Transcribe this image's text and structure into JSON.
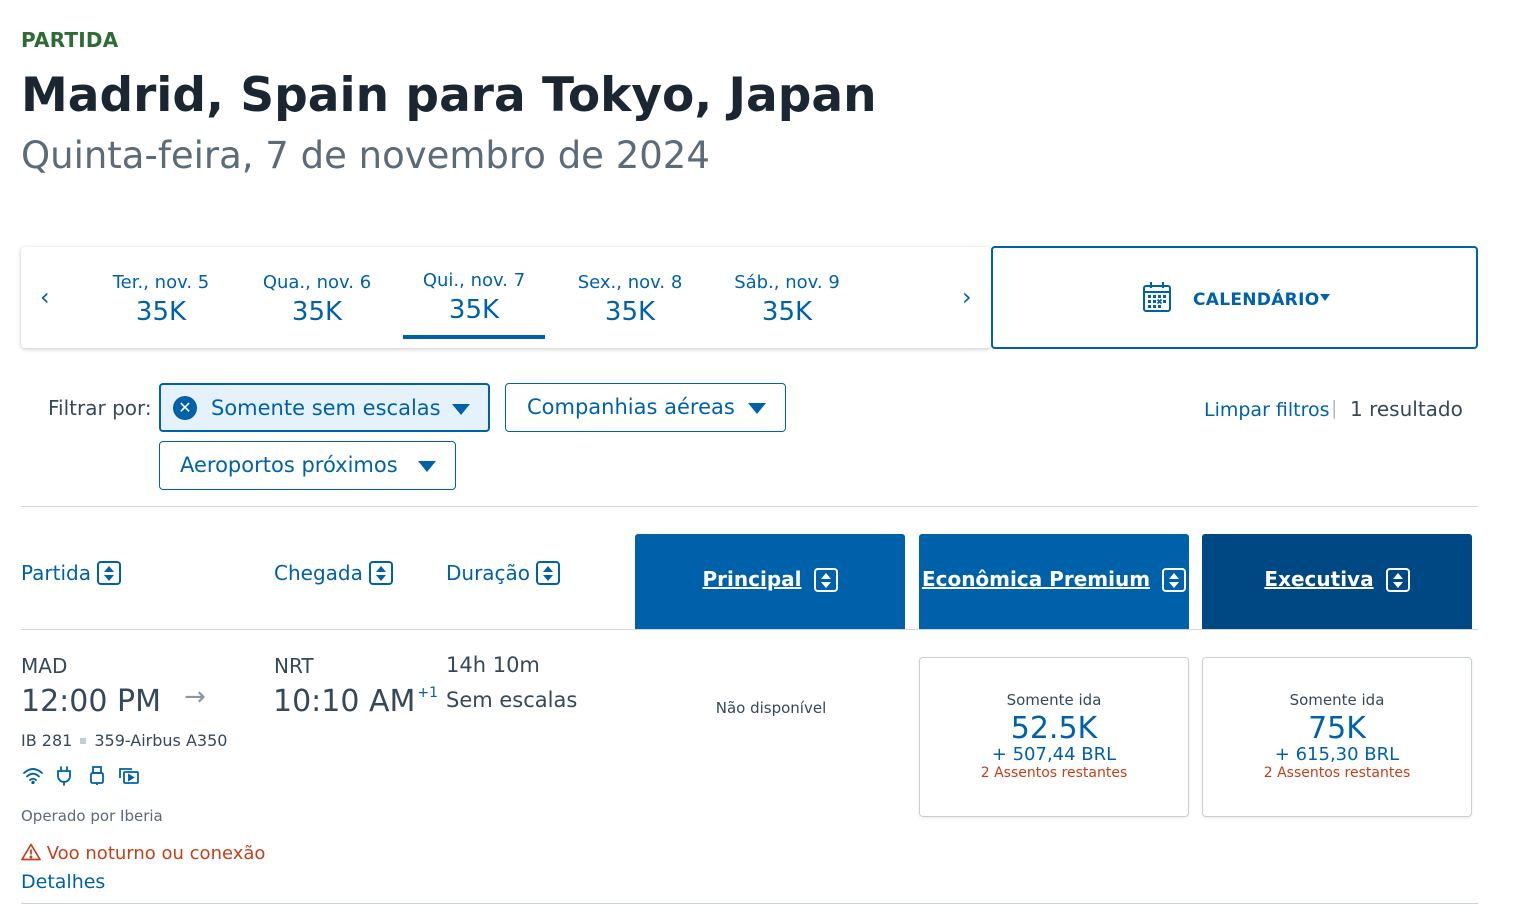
{
  "header": {
    "eyebrow": "PARTIDA",
    "route": "Madrid, Spain para Tokyo, Japan",
    "date": "Quinta-feira, 7 de novembro de 2024"
  },
  "date_strip": {
    "prev": "‹",
    "next": "›",
    "days": [
      {
        "label": "Ter., nov. 5",
        "price": "35K"
      },
      {
        "label": "Qua., nov. 6",
        "price": "35K"
      },
      {
        "label": "Qui., nov. 7",
        "price": "35K",
        "selected": true
      },
      {
        "label": "Sex., nov. 8",
        "price": "35K"
      },
      {
        "label": "Sáb., nov. 9",
        "price": "35K"
      }
    ],
    "calendar_label": "CALENDÁRIO"
  },
  "filters": {
    "label": "Filtrar por:",
    "chips": [
      {
        "label": "Somente sem escalas",
        "selected": true
      },
      {
        "label": "Companhias aéreas"
      },
      {
        "label": "Aeroportos próximos"
      }
    ],
    "clear": "Limpar filtros",
    "separator": "|",
    "results": "1 resultado"
  },
  "columns": {
    "departure": "Partida",
    "arrival": "Chegada",
    "duration": "Duração",
    "cabins": [
      "Principal",
      "Econômica Premium",
      "Executiva"
    ]
  },
  "flight": {
    "origin": "MAD",
    "depart_time": "12:00 PM",
    "destination": "NRT",
    "arrive_time": "10:10 AM",
    "day_offset": "+1",
    "duration": "14h 10m",
    "stops": "Sem escalas",
    "flight_number": "IB 281",
    "aircraft": "359-Airbus A350",
    "amenities": [
      "wifi-icon",
      "power-outlet-icon",
      "usb-icon",
      "entertainment-icon"
    ],
    "operated_by": "Operado por Iberia",
    "warning": "Voo noturno ou conexão",
    "details": "Detalhes",
    "fares": {
      "principal": "Não disponível",
      "premium": {
        "type": "Somente ida",
        "price": "52.5K",
        "cash": "+ 507,44 BRL",
        "seats": "2 Assentos restantes"
      },
      "executiva": {
        "type": "Somente ida",
        "price": "75K",
        "cash": "+ 615,30 BRL",
        "seats": "2 Assentos restantes"
      }
    }
  },
  "colors": {
    "accent": "#0061ab",
    "cabin_dark": "#004883",
    "eyebrow": "#2f6b33",
    "warning": "#c3401a"
  }
}
